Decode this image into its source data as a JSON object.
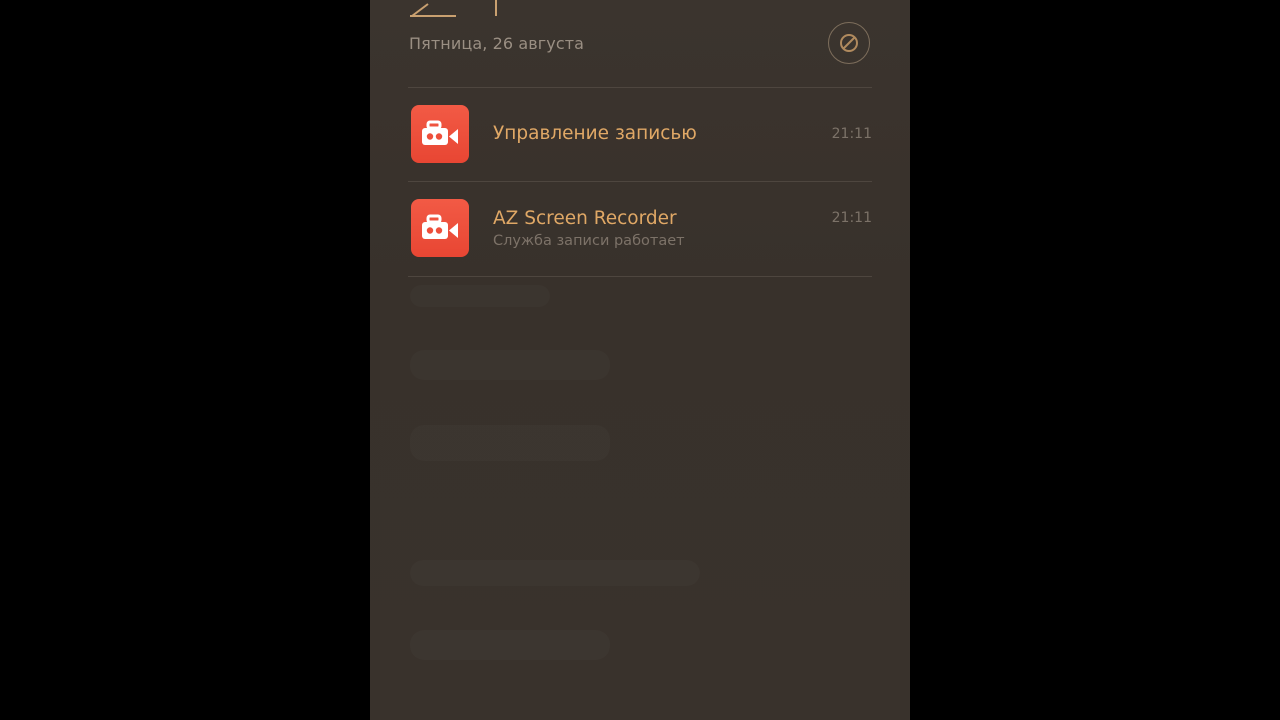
{
  "lockscreen": {
    "date": "Пятница, 26 августа",
    "clear_icon": "block-icon"
  },
  "notifications": [
    {
      "app_icon": "video-camera-icon",
      "title": "Управление записью",
      "subtitle": "",
      "time": "21:11"
    },
    {
      "app_icon": "video-camera-icon",
      "title": "AZ Screen Recorder",
      "subtitle": "Служба записи работает",
      "time": "21:11"
    }
  ],
  "colors": {
    "accent": "#e0a866",
    "icon_bg": "#ee4f3b",
    "panel_bg": "#3a332d"
  }
}
